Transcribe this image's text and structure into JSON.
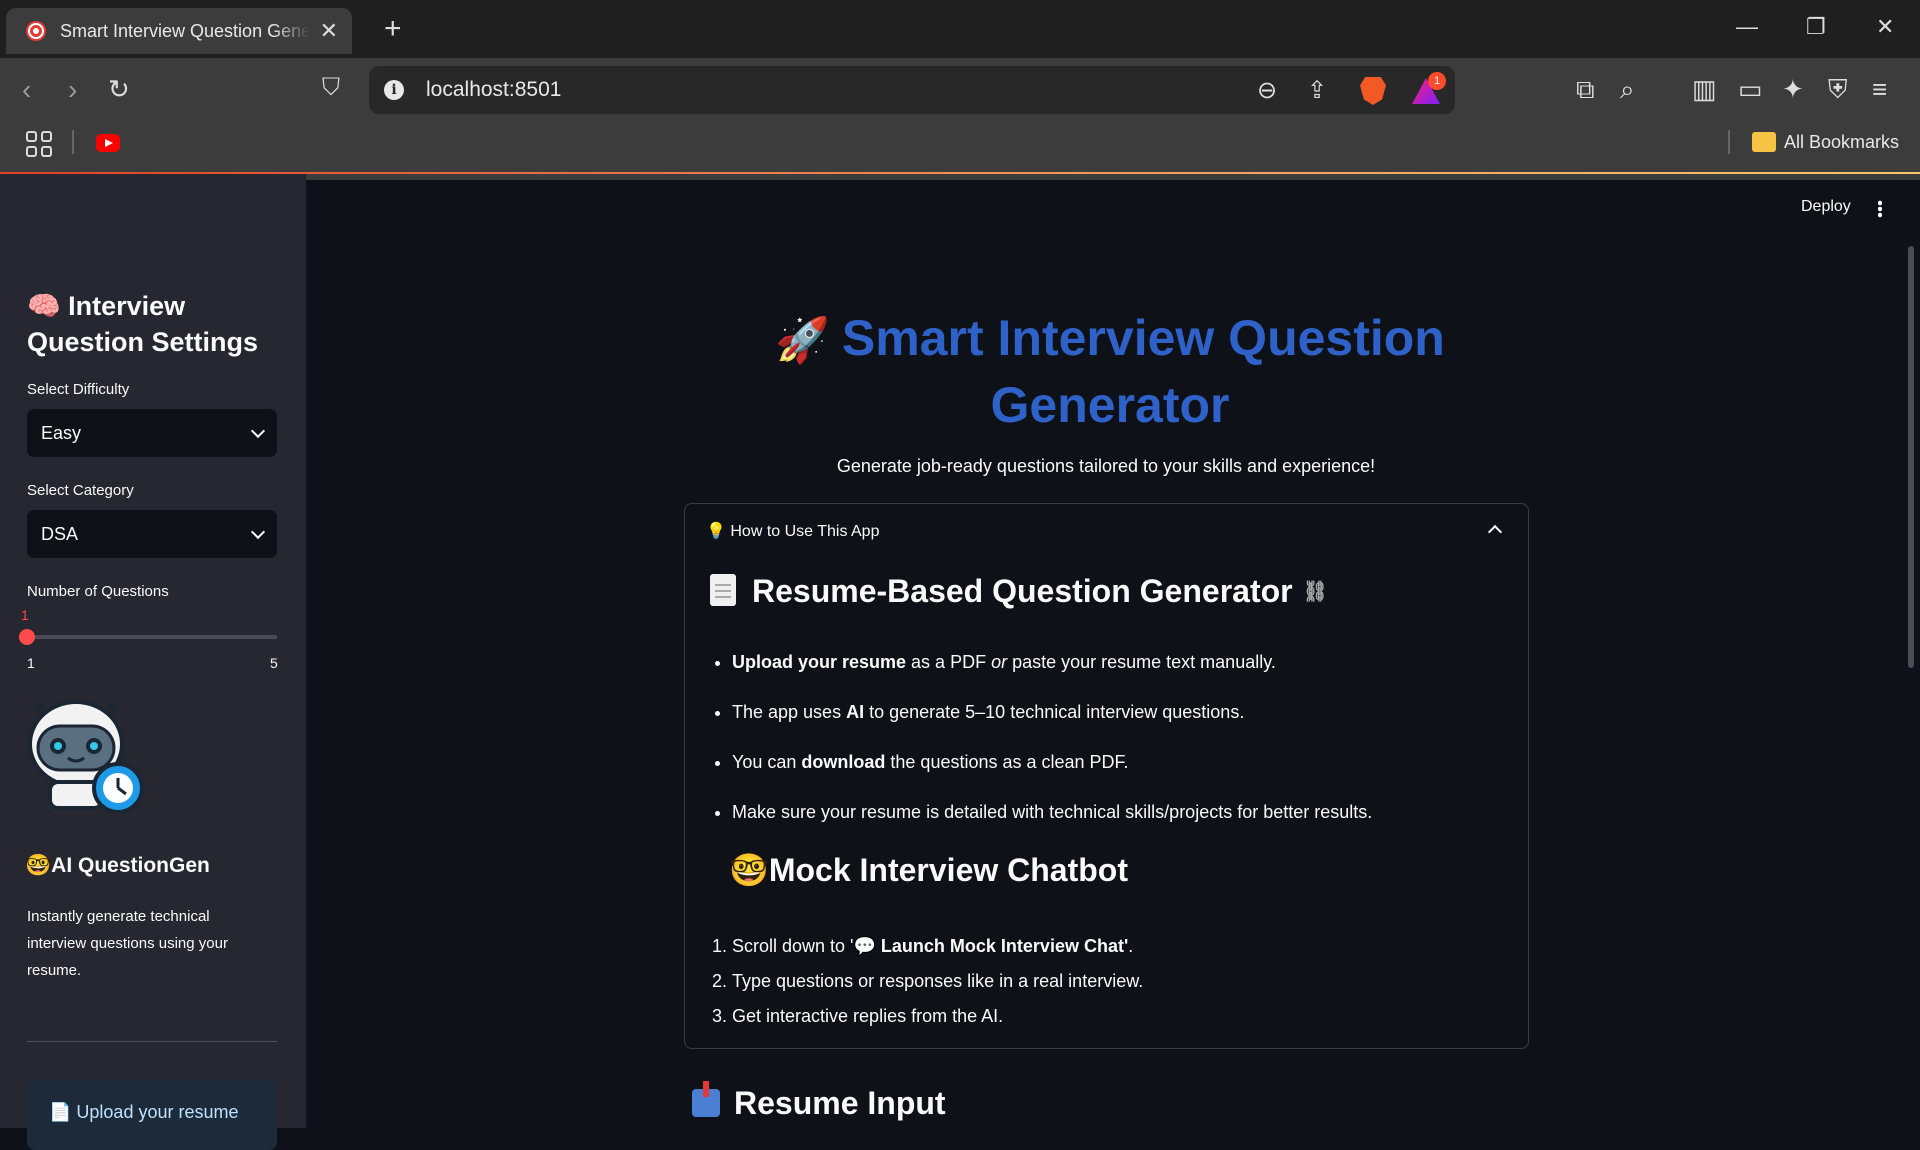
{
  "browser": {
    "tab_title": "Smart Interview Question Generator",
    "url": "localhost:8501",
    "bookmarks_label": "All Bookmarks",
    "notification_count": "1"
  },
  "sidebar": {
    "title": "🧠 Interview Question Settings",
    "difficulty_label": "Select Difficulty",
    "difficulty_value": "Easy",
    "category_label": "Select Category",
    "category_value": "DSA",
    "num_questions_label": "Number of Questions",
    "slider_value": "1",
    "slider_min": "1",
    "slider_max": "5",
    "brand": "🤓AI QuestionGen",
    "description": "Instantly generate technical interview questions using your resume.",
    "upload_hint": "📄 Upload your resume"
  },
  "header": {
    "deploy_label": "Deploy"
  },
  "main": {
    "title": "Smart Interview Question Generator",
    "subtitle": "Generate job-ready questions tailored to your skills and experience!",
    "expander_label": "💡 How to Use This App",
    "section1_title": "Resume-Based Question Generator",
    "bullets": [
      {
        "bold": "Upload your resume",
        "mid": " as a PDF ",
        "italic": "or",
        "rest": " paste your resume text manually."
      },
      {
        "pre": "The app uses ",
        "bold": "AI",
        "rest": " to generate 5–10 technical interview questions."
      },
      {
        "pre": "You can ",
        "bold": "download",
        "rest": " the questions as a clean PDF."
      },
      {
        "text": "Make sure your resume is detailed with technical skills/projects for better results."
      }
    ],
    "section2_title": "🤓Mock Interview Chatbot",
    "steps": [
      {
        "pre": "Scroll down to '",
        "bold": "💬 Launch Mock Interview Chat'",
        "rest": "."
      },
      {
        "text": "Type questions or responses like in a real interview."
      },
      {
        "text": "Get interactive replies from the AI."
      }
    ],
    "section3_title": "Resume Input"
  },
  "colors": {
    "accent": "#ff4b4b",
    "title_blue": "#2f62c9",
    "sidebar_bg": "#262730",
    "main_bg": "#0e1117"
  }
}
